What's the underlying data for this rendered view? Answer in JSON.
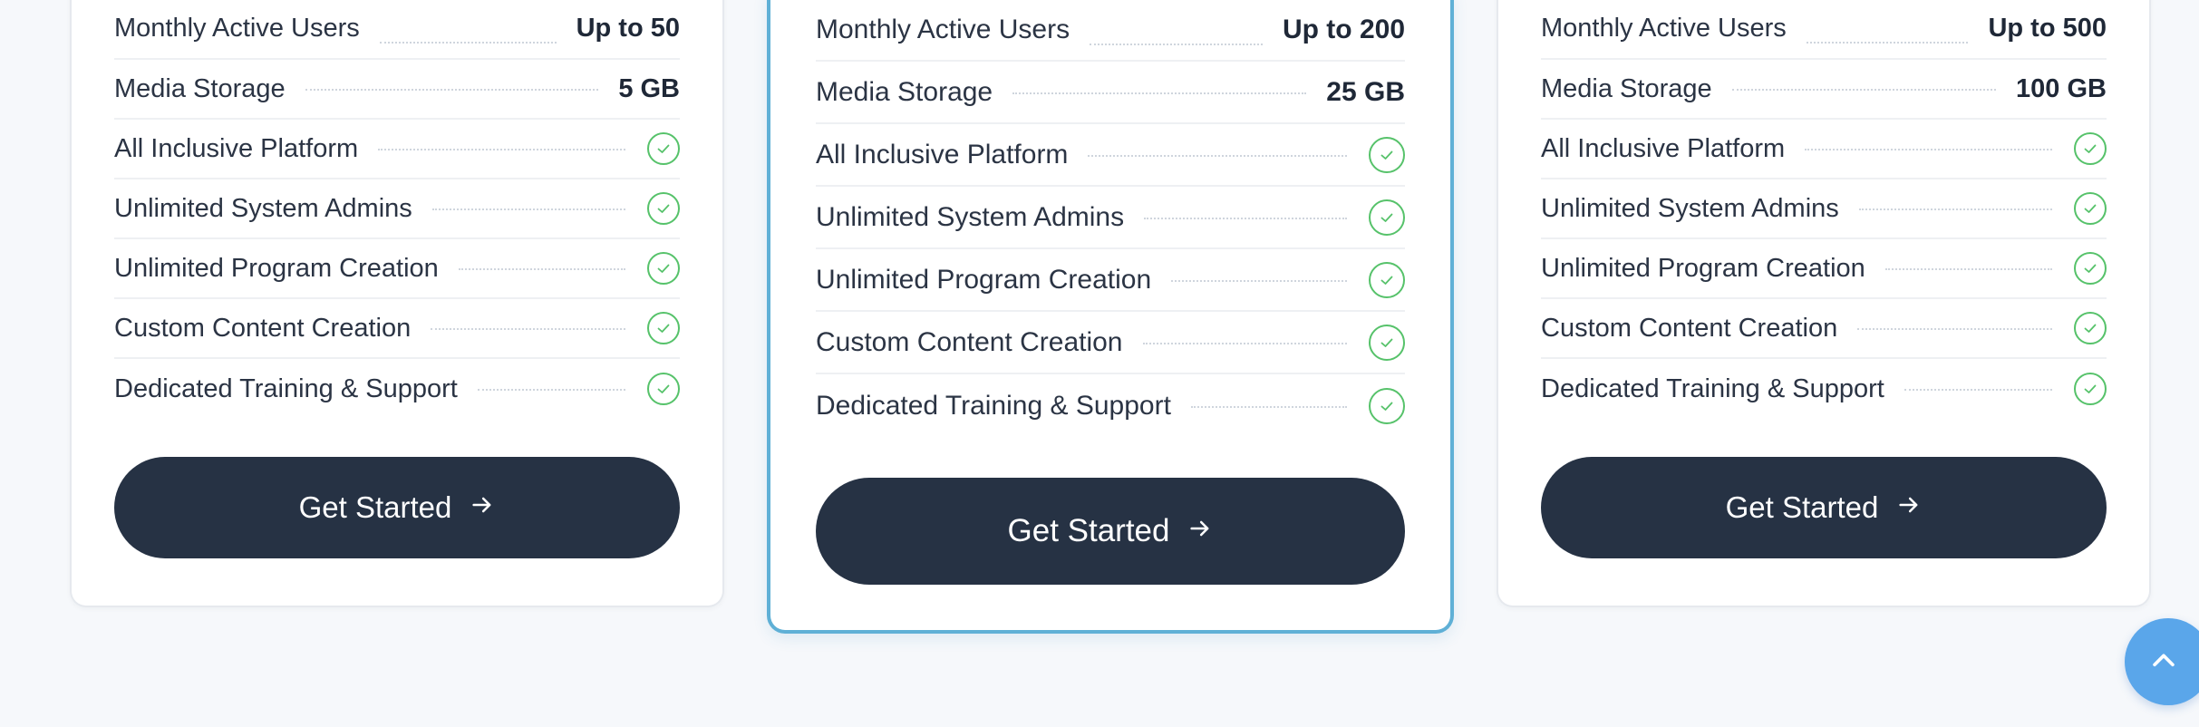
{
  "plans": [
    {
      "features": [
        {
          "label": "Monthly Active Users",
          "value": "Up to 50"
        },
        {
          "label": "Media Storage",
          "value": "5 GB"
        },
        {
          "label": "All Inclusive Platform",
          "included": true
        },
        {
          "label": "Unlimited System Admins",
          "included": true
        },
        {
          "label": "Unlimited Program Creation",
          "included": true
        },
        {
          "label": "Custom Content Creation",
          "included": true
        },
        {
          "label": "Dedicated Training & Support",
          "included": true
        }
      ],
      "cta_label": "Get Started"
    },
    {
      "highlighted": true,
      "features": [
        {
          "label": "Monthly Active Users",
          "value": "Up to 200"
        },
        {
          "label": "Media Storage",
          "value": "25 GB"
        },
        {
          "label": "All Inclusive Platform",
          "included": true
        },
        {
          "label": "Unlimited System Admins",
          "included": true
        },
        {
          "label": "Unlimited Program Creation",
          "included": true
        },
        {
          "label": "Custom Content Creation",
          "included": true
        },
        {
          "label": "Dedicated Training & Support",
          "included": true
        }
      ],
      "cta_label": "Get Started"
    },
    {
      "features": [
        {
          "label": "Monthly Active Users",
          "value": "Up to 500"
        },
        {
          "label": "Media Storage",
          "value": "100 GB"
        },
        {
          "label": "All Inclusive Platform",
          "included": true
        },
        {
          "label": "Unlimited System Admins",
          "included": true
        },
        {
          "label": "Unlimited Program Creation",
          "included": true
        },
        {
          "label": "Custom Content Creation",
          "included": true
        },
        {
          "label": "Dedicated Training & Support",
          "included": true
        }
      ],
      "cta_label": "Get Started"
    }
  ],
  "icons": {
    "check": "check-circle-icon",
    "cta_arrow": "arrow-right-icon",
    "scroll_top": "chevron-up-icon"
  },
  "colors": {
    "background": "#f6f8fb",
    "card": "#ffffff",
    "highlight_border": "#5fb0d6",
    "button": "#263244",
    "check": "#56c26a",
    "scroll_top_button": "#5aa6ea"
  }
}
